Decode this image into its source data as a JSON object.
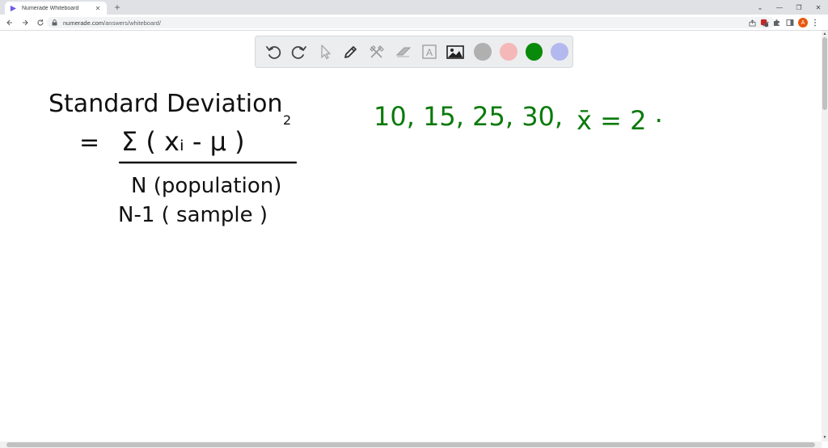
{
  "browser": {
    "tab_title": "Numerade Whiteboard",
    "url_domain": "numerade.com",
    "url_path": "/answers/whiteboard/",
    "avatar_letter": "A"
  },
  "palette": {
    "tools": [
      "undo-icon",
      "redo-icon",
      "pointer-icon",
      "pen-icon",
      "clear-icon",
      "eraser-icon",
      "text-tool-icon",
      "image-icon"
    ],
    "text_tool_label": "A",
    "swatches": [
      "#b0b0b0",
      "#f4b8b8",
      "#0a8a0a",
      "#b3b8ee"
    ]
  },
  "ink": {
    "title": "Standard Deviation",
    "equals": "=",
    "numerator": "Σ ( xᵢ - μ )",
    "exponent": "2",
    "denominator_population": "N  (population)",
    "denominator_sample": "N-1  ( sample )",
    "data_list": "10, 15, 25, 30,",
    "mean_label": "x̄ = 2 ·",
    "ink_black": "#111111",
    "ink_green": "#0a7a0a"
  }
}
